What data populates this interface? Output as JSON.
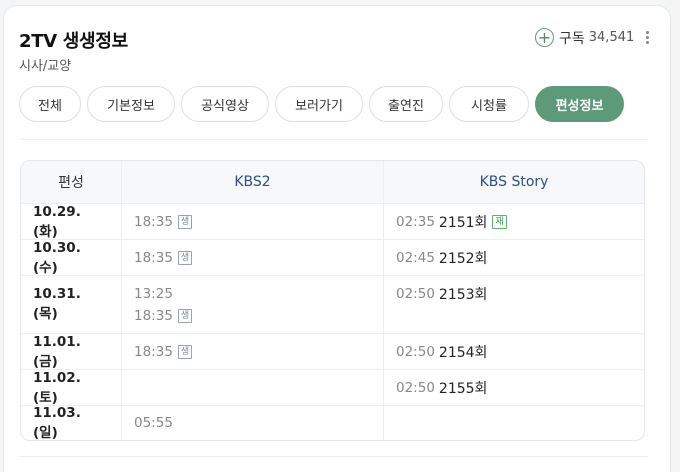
{
  "header": {
    "title": "2TV 생생정보",
    "subtitle": "시사/교양",
    "subscribe_label": "구독",
    "subscribe_count": "34,541"
  },
  "tabs": [
    {
      "label": "전체"
    },
    {
      "label": "기본정보"
    },
    {
      "label": "공식영상"
    },
    {
      "label": "보러가기"
    },
    {
      "label": "출연진"
    },
    {
      "label": "시청률"
    },
    {
      "label": "편성정보",
      "active": true
    }
  ],
  "schedule": {
    "header": {
      "col1": "편성",
      "col2": "KBS2",
      "col3": "KBS Story"
    },
    "rows": [
      {
        "date": "10.29. (화)",
        "kbs2": [
          {
            "time": "18:35",
            "badge": "생"
          }
        ],
        "story": [
          {
            "time": "02:35",
            "ep": "2151회",
            "badge": "재"
          }
        ]
      },
      {
        "date": "10.30. (수)",
        "kbs2": [
          {
            "time": "18:35",
            "badge": "생"
          }
        ],
        "story": [
          {
            "time": "02:45",
            "ep": "2152회"
          }
        ]
      },
      {
        "date": "10.31. (목)",
        "kbs2": [
          {
            "time": "13:25"
          },
          {
            "time": "18:35",
            "badge": "생"
          }
        ],
        "story": [
          {
            "time": "02:50",
            "ep": "2153회"
          }
        ]
      },
      {
        "date": "11.01. (금)",
        "kbs2": [
          {
            "time": "18:35",
            "badge": "생"
          }
        ],
        "story": [
          {
            "time": "02:50",
            "ep": "2154회"
          }
        ]
      },
      {
        "date": "11.02. (토)",
        "kbs2": [],
        "story": [
          {
            "time": "02:50",
            "ep": "2155회"
          }
        ]
      },
      {
        "date": "11.03. (일)",
        "kbs2": [
          {
            "time": "05:55"
          }
        ],
        "story": []
      }
    ]
  },
  "colors": {
    "accent": "#5c9a79",
    "channel_header": "#2d4e8a",
    "rerun_badge": "#3a9c47"
  }
}
